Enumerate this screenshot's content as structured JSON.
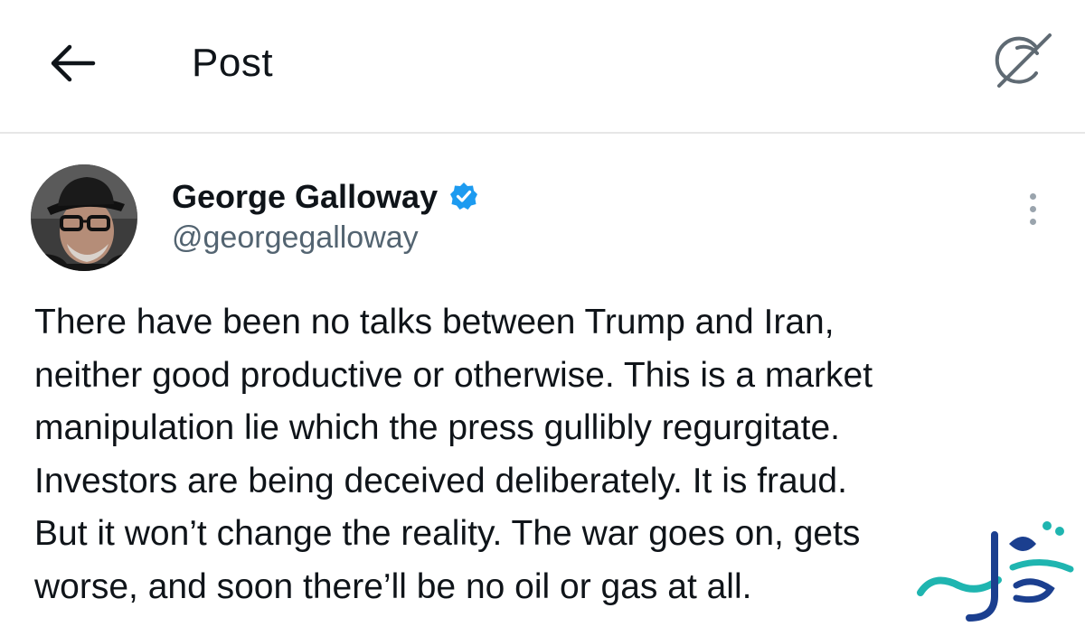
{
  "header": {
    "title": "Post",
    "back_icon": "arrow-left-icon",
    "grok_icon": "grok-slash-icon"
  },
  "author": {
    "name": "George Galloway",
    "handle": "@georgegalloway",
    "verified": true,
    "verified_color": "#1d9bf0"
  },
  "post": {
    "lines": [
      "There have been no talks between Trump and Iran,",
      "neither good productive or otherwise. This is a market",
      "manipulation lie which the press gullibly regurgitate.",
      "Investors are being deceived deliberately. It is fraud.",
      "But it won’t change the reality. The war goes on, gets",
      "worse, and soon there’ll be no oil or gas at all."
    ]
  },
  "watermark": {
    "text": "صفحه اقتصاد",
    "colors": [
      "#1fb5b0",
      "#1b3f8f"
    ]
  },
  "colors": {
    "text_primary": "#0f1419",
    "text_secondary": "#536471",
    "divider": "#e6e6e6"
  }
}
